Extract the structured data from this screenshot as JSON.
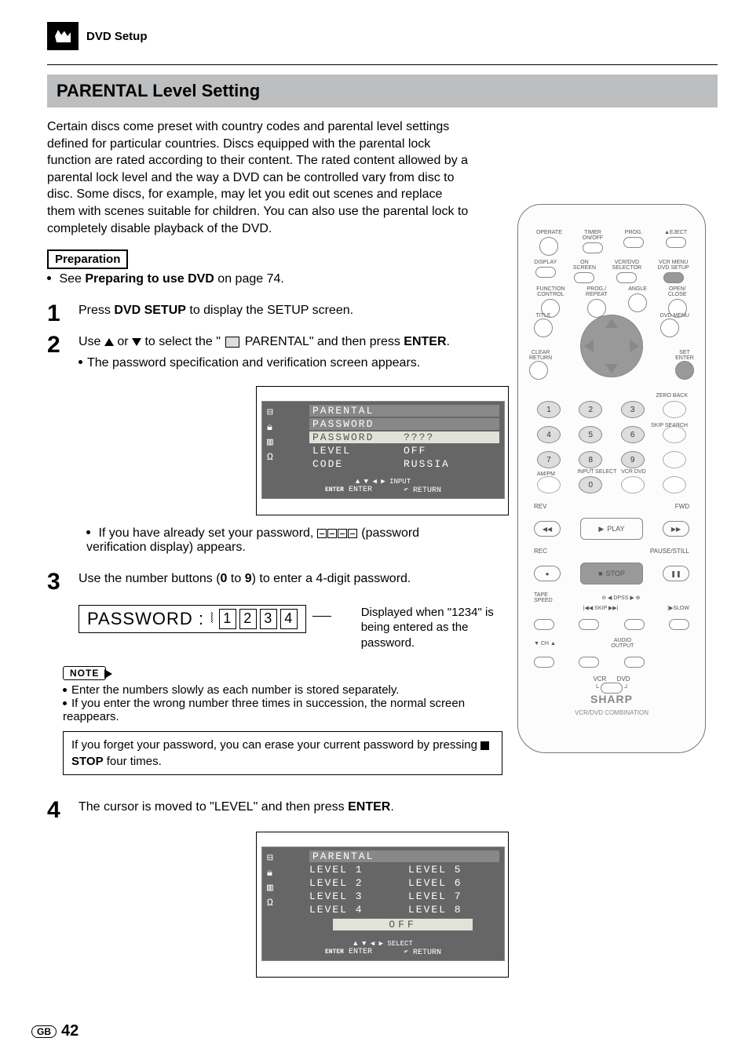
{
  "header": {
    "section": "DVD Setup"
  },
  "title": "PARENTAL Level Setting",
  "intro": "Certain discs come preset with country codes and parental level settings defined for particular countries. Discs equipped with the parental lock function are rated according to their content. The rated content allowed by a parental lock level and the way a DVD can be controlled vary from disc to disc. Some discs, for example, may let you edit out scenes and replace them with scenes suitable for children. You can also use the parental lock to completely disable playback of the DVD.",
  "preparation": {
    "label": "Preparation",
    "text_pre": "See ",
    "text_bold": "Preparing to use DVD",
    "text_post": " on page 74."
  },
  "steps": {
    "s1": {
      "num": "1",
      "pre": "Press ",
      "b1": "DVD SETUP",
      "post": " to display the SETUP screen."
    },
    "s2": {
      "num": "2",
      "pre": "Use ",
      "mid": " or ",
      "mid2": " to select the \" ",
      "mid3": " PARENTAL\" and then press ",
      "b1": "ENTER",
      "post": ".",
      "bullet": "The password specification and verification screen appears."
    },
    "s2b": {
      "pre": "If you have already set your password, ",
      "post": " (password verification display) appears."
    },
    "s3": {
      "num": "3",
      "pre": "Use the number buttons (",
      "b1": "0",
      "mid": " to ",
      "b2": "9",
      "post": ") to enter a 4-digit password."
    },
    "s4": {
      "num": "4",
      "text": "The cursor is moved to \"LEVEL\" and then press ",
      "b1": "ENTER",
      "post": "."
    }
  },
  "osd1": {
    "title": "PARENTAL",
    "sub": "PASSWORD",
    "row_pw_k": "PASSWORD",
    "row_pw_v": "????",
    "row_lv_k": "LEVEL",
    "row_lv_v": "OFF",
    "row_cd_k": "CODE",
    "row_cd_v": "RUSSIA",
    "foot1": "INPUT",
    "foot_enter": "ENTER",
    "foot_enter_lbl": "ENTER",
    "foot_return": "RETURN"
  },
  "pw_entry": {
    "label": "PASSWORD :",
    "digits": [
      "1",
      "2",
      "3",
      "4"
    ],
    "note": "Displayed when \"1234\" is being entered as the password."
  },
  "note": {
    "label": "NOTE",
    "b1": "Enter the numbers slowly as each number is stored separately.",
    "b2": "If you enter the wrong number three times in succession, the normal screen reappears."
  },
  "forget": {
    "pre": "If you forget your password, you can erase your current password by pressing ",
    "b": "STOP",
    "post": " four times."
  },
  "osd2": {
    "title": "PARENTAL",
    "levels": [
      "LEVEL 1",
      "LEVEL 5",
      "LEVEL 2",
      "LEVEL 6",
      "LEVEL 3",
      "LEVEL 7",
      "LEVEL 4",
      "LEVEL 8"
    ],
    "off": "OFF",
    "foot1": "SELECT",
    "foot_enter": "ENTER",
    "foot_enter_lbl": "ENTER",
    "foot_return": "RETURN"
  },
  "remote": {
    "r1": [
      "OPERATE",
      "TIMER\nON/OFF",
      "PROG.",
      "EJECT"
    ],
    "r2": [
      "DISPLAY",
      "ON\nSCREEN",
      "VCR/DVD\nSELECTOR",
      "VCR MENU\nDVD SETUP"
    ],
    "r3": [
      "FUNCTION\nCONTROL",
      "PROG./\nREPEAT",
      "ANGLE",
      "OPEN/\nCLOSE"
    ],
    "title": "TITLE",
    "dvdmenu": "DVD MENU",
    "clear": "CLEAR\nRETURN",
    "set": "SET\nENTER",
    "zeroback": "ZERO BACK",
    "skipsearch": "SKIP SEARCH",
    "ampm": "AM/PM",
    "inputselect": "INPUT SELECT",
    "vcrdvd": "VCR    DVD",
    "rev": "REV",
    "fwd": "FWD",
    "play": "PLAY",
    "rec": "REC",
    "stop": "STOP",
    "pause": "PAUSE/STILL",
    "tape": "TAPE\nSPEED",
    "dpss": "DPSS",
    "skip": "SKIP",
    "slow": "SLOW",
    "ch": "CH",
    "audio": "AUDIO\nOUTPUT",
    "mode_vcr": "VCR",
    "mode_dvd": "DVD",
    "brand": "SHARP",
    "brand_sub": "VCR/DVD COMBINATION"
  },
  "footer": {
    "region": "GB",
    "page": "42"
  }
}
